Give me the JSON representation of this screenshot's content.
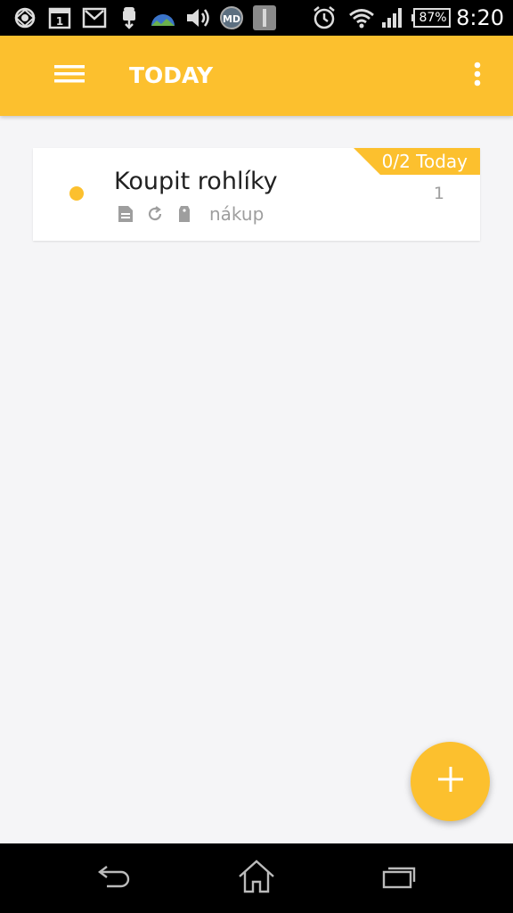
{
  "status_bar": {
    "battery_percent": "87%",
    "time": "8:20"
  },
  "app_bar": {
    "title": "TODAY"
  },
  "tasks": [
    {
      "title": "Koupit rohlíky",
      "tag": "nákup",
      "badge": "0/2 Today",
      "count": "1",
      "color": "#fcc02e"
    }
  ],
  "fab": {
    "icon": "plus-icon"
  },
  "colors": {
    "accent": "#fcc02e",
    "background": "#f5f5f7",
    "text_primary": "#212121",
    "text_secondary": "#9e9e9e"
  }
}
